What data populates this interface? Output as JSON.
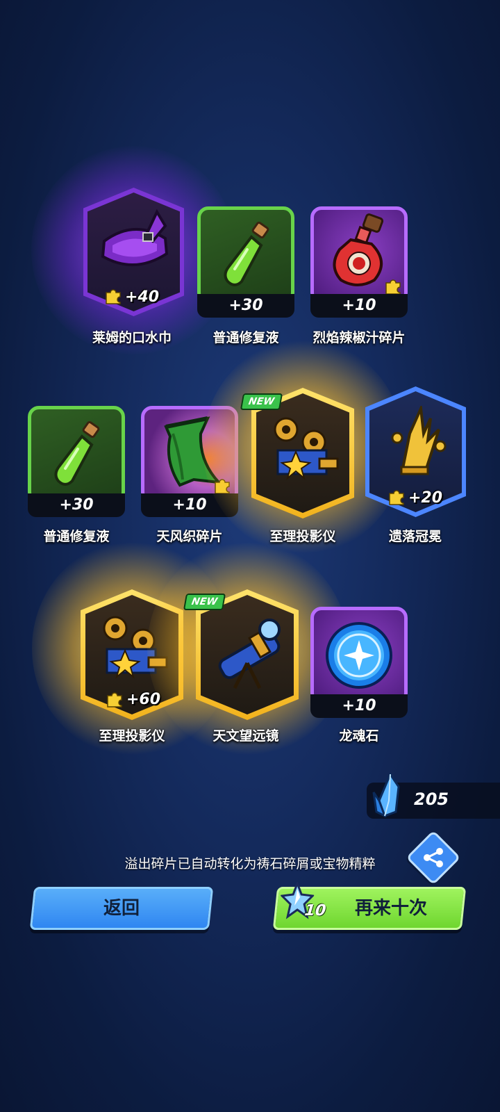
{
  "rows": [
    [
      {
        "name": "莱姆的口水巾",
        "count": "+40",
        "frame": "purple-hex",
        "icon": "purple-bandana-icon",
        "new": false
      },
      {
        "name": "普通修复液",
        "count": "+30",
        "frame": "green",
        "icon": "green-potion-icon",
        "new": false
      },
      {
        "name": "烈焰辣椒汁碎片",
        "count": "+10",
        "frame": "purple",
        "icon": "chili-potion-icon",
        "new": false
      }
    ],
    [
      {
        "name": "普通修复液",
        "count": "+30",
        "frame": "green",
        "icon": "green-potion-icon",
        "new": false
      },
      {
        "name": "天风织碎片",
        "count": "+10",
        "frame": "purple",
        "icon": "green-cloak-icon",
        "new": false
      },
      {
        "name": "至理投影仪",
        "count": "",
        "frame": "gold-hex",
        "icon": "projector-icon",
        "new": true
      },
      {
        "name": "遗落冠冕",
        "count": "+20",
        "frame": "blue-hex",
        "icon": "golden-crown-icon",
        "new": false
      }
    ],
    [
      {
        "name": "至理投影仪",
        "count": "+60",
        "frame": "gold-hex",
        "icon": "projector-icon",
        "new": false
      },
      {
        "name": "天文望远镜",
        "count": "",
        "frame": "gold-hex",
        "icon": "telescope-icon",
        "new": true
      },
      {
        "name": "龙魂石",
        "count": "+10",
        "frame": "purple",
        "icon": "dragon-soul-orb-icon",
        "new": false
      }
    ]
  ],
  "new_label": "NEW",
  "currency": {
    "amount": "205",
    "icon": "blue-crystal-icon"
  },
  "notice": "溢出碎片已自动转化为祷石碎屑或宝物精粹",
  "buttons": {
    "back_label": "返回",
    "again_label": "再来十次",
    "again_cost": "10",
    "cost_icon": "star-crystal-icon",
    "share_icon": "share-icon"
  },
  "colors": {
    "rare_purple": "#b76cff",
    "common_green": "#68d34a",
    "legendary_gold": "#ffd34a",
    "epic_blue": "#4c86ff"
  }
}
